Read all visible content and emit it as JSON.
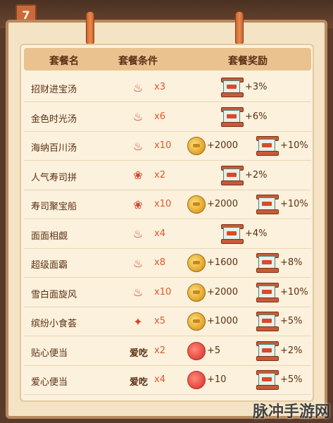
{
  "date_badge": "7",
  "header": {
    "col_name": "套餐名",
    "col_condition": "套餐条件",
    "col_reward": "套餐奖励"
  },
  "rows": [
    {
      "name": "招财进宝汤",
      "cond_icon": "soup-bowl-icon",
      "cond_text": "",
      "cond_qty": "x3",
      "rewards": [
        {
          "icon": "scroll-icon",
          "text": "+3%"
        }
      ]
    },
    {
      "name": "金色时光汤",
      "cond_icon": "soup-bowl-icon",
      "cond_text": "",
      "cond_qty": "x6",
      "rewards": [
        {
          "icon": "scroll-icon",
          "text": "+6%"
        }
      ]
    },
    {
      "name": "海纳百川汤",
      "cond_icon": "soup-bowl-icon",
      "cond_text": "",
      "cond_qty": "x10",
      "rewards": [
        {
          "icon": "coin-icon",
          "text": "+2000"
        },
        {
          "icon": "scroll-icon",
          "text": "+10%"
        }
      ]
    },
    {
      "name": "人气寿司拼",
      "cond_icon": "sushi-icon",
      "cond_text": "",
      "cond_qty": "x2",
      "rewards": [
        {
          "icon": "scroll-icon",
          "text": "+2%"
        }
      ]
    },
    {
      "name": "寿司聚宝船",
      "cond_icon": "sushi-icon",
      "cond_text": "",
      "cond_qty": "x10",
      "rewards": [
        {
          "icon": "coin-icon",
          "text": "+2000"
        },
        {
          "icon": "scroll-icon",
          "text": "+10%"
        }
      ]
    },
    {
      "name": "面面相觑",
      "cond_icon": "noodle-bowl-icon",
      "cond_text": "",
      "cond_qty": "x4",
      "rewards": [
        {
          "icon": "scroll-icon",
          "text": "+4%"
        }
      ]
    },
    {
      "name": "超级面霸",
      "cond_icon": "noodle-bowl-icon",
      "cond_text": "",
      "cond_qty": "x8",
      "rewards": [
        {
          "icon": "coin-icon",
          "text": "+1600"
        },
        {
          "icon": "scroll-icon",
          "text": "+8%"
        }
      ]
    },
    {
      "name": "雪白面旋风",
      "cond_icon": "noodle-bowl-icon",
      "cond_text": "",
      "cond_qty": "x10",
      "rewards": [
        {
          "icon": "coin-icon",
          "text": "+2000"
        },
        {
          "icon": "scroll-icon",
          "text": "+10%"
        }
      ]
    },
    {
      "name": "缤纷小食荟",
      "cond_icon": "skewer-icon",
      "cond_text": "",
      "cond_qty": "x5",
      "rewards": [
        {
          "icon": "coin-icon",
          "text": "+1000"
        },
        {
          "icon": "scroll-icon",
          "text": "+5%"
        }
      ]
    },
    {
      "name": "贴心便当",
      "cond_icon": "",
      "cond_text": "爱吃",
      "cond_qty": "x2",
      "rewards": [
        {
          "icon": "heart-bubble-icon",
          "text": "+5"
        },
        {
          "icon": "scroll-icon",
          "text": "+2%"
        }
      ]
    },
    {
      "name": "爱心便当",
      "cond_icon": "",
      "cond_text": "爱吃",
      "cond_qty": "x4",
      "rewards": [
        {
          "icon": "heart-bubble-icon",
          "text": "+10"
        },
        {
          "icon": "scroll-icon",
          "text": "+5%"
        }
      ]
    }
  ],
  "watermark": "脉冲手游网"
}
